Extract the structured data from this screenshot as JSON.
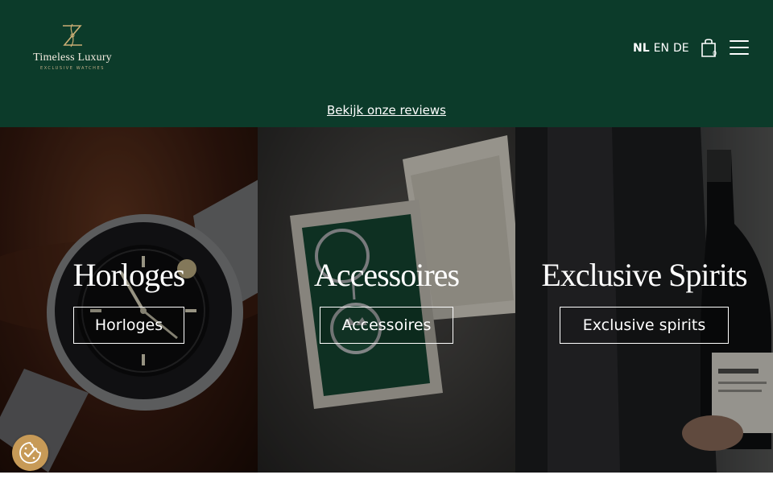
{
  "brand": {
    "name": "Timeless Luxury",
    "tagline": "EXCLUSIVE WATCHES"
  },
  "colors": {
    "header_bg": "#0c3b2a",
    "gold": "#c79a57",
    "text_light": "#ffffff"
  },
  "languages": [
    {
      "code": "NL",
      "active": true
    },
    {
      "code": "EN",
      "active": false
    },
    {
      "code": "DE",
      "active": false
    }
  ],
  "cart": {
    "count": "0",
    "icon": "shopping-bag-icon"
  },
  "menu": {
    "icon": "hamburger-menu-icon"
  },
  "reviews_link": "Bekijk onze reviews",
  "categories": [
    {
      "title": "Horloges",
      "button": "Horloges"
    },
    {
      "title": "Accessoires",
      "button": "Accessoires"
    },
    {
      "title": "Exclusive Spirits",
      "button": "Exclusive spirits"
    }
  ],
  "cookie": {
    "icon": "cookie-consent-icon"
  }
}
